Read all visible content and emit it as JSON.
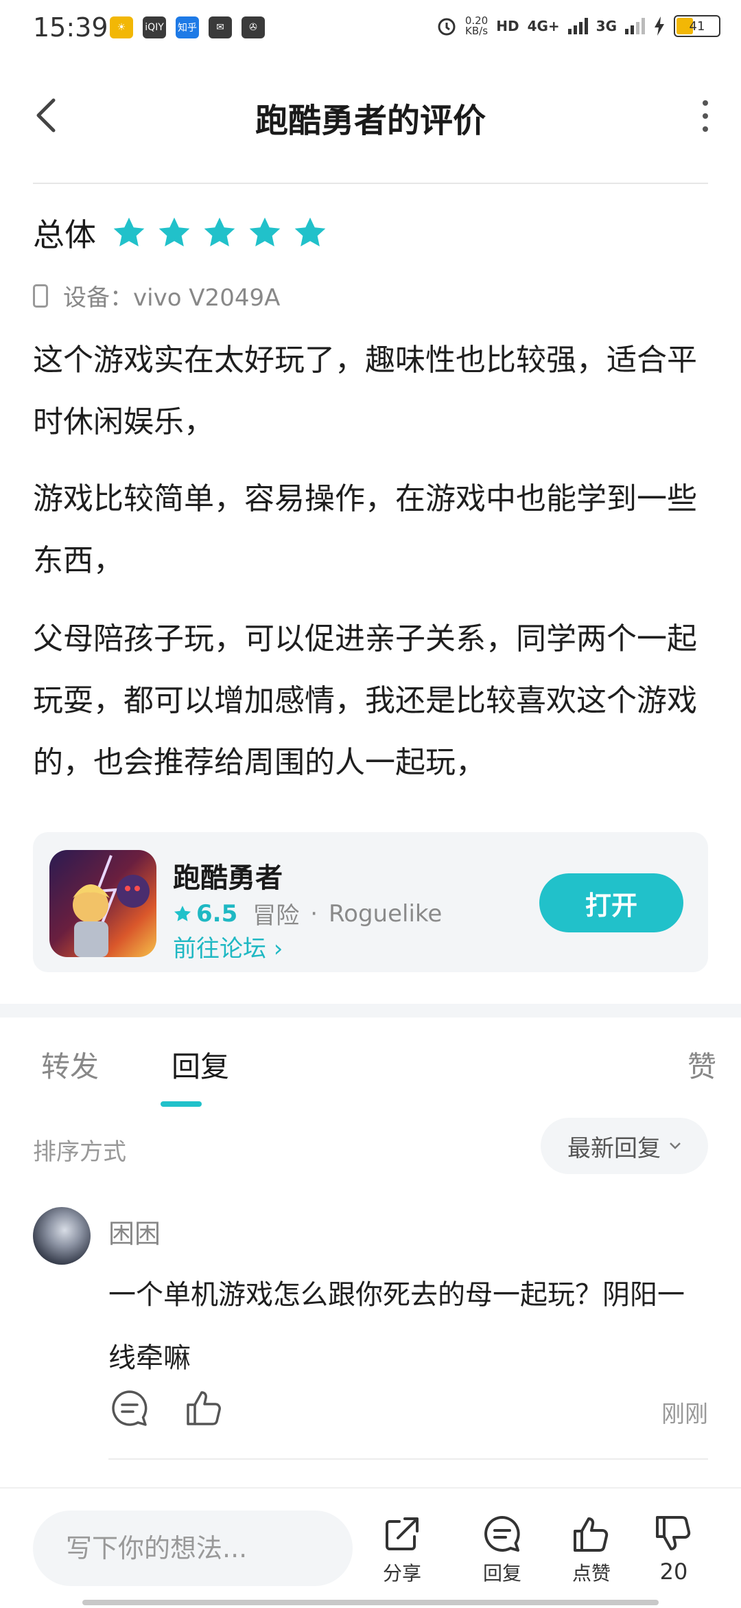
{
  "status_bar": {
    "time": "15:39",
    "net_speed": "0.20",
    "net_speed_unit": "KB/s",
    "hd": "HD",
    "net1": "4G+",
    "net2": "3G",
    "battery": "41",
    "app_icons": [
      "weather-icon",
      "iqiyi-icon",
      "zhihu-icon",
      "mail-icon",
      "vpn-icon"
    ],
    "zhihu_text": "知乎",
    "iqiyi_text": "iQIY"
  },
  "header": {
    "title": "跑酷勇者的评价"
  },
  "rating": {
    "label": "总体",
    "stars": 5,
    "star_color": "#21c1ca"
  },
  "device": {
    "label": "设备：vivo V2049A"
  },
  "review": {
    "paragraphs": [
      "这个游戏实在太好玩了，趣味性也比较强，适合平时休闲娱乐，",
      "游戏比较简单，容易操作，在游戏中也能学到一些东西，",
      "父母陪孩子玩，可以促进亲子关系，同学两个一起玩耍，都可以增加感情，我还是比较喜欢这个游戏的，也会推荐给周围的人一起玩，"
    ]
  },
  "game_card": {
    "name": "跑酷勇者",
    "score": "6.5",
    "genre": "冒险",
    "separator": "·",
    "tag": "Roguelike",
    "forum_link": "前往论坛 ›",
    "open_button": "打开",
    "accent_color": "#21c1ca"
  },
  "tabs": {
    "forward": "转发",
    "reply": "回复",
    "like": "赞",
    "active": "reply"
  },
  "sort": {
    "label": "排序方式",
    "selected": "最新回复"
  },
  "comments": [
    {
      "user": "困困",
      "text": "一个单机游戏怎么跟你死去的母一起玩？阴阳一线牵嘛",
      "time": "刚刚"
    }
  ],
  "bottom_bar": {
    "input_placeholder": "写下你的想法...",
    "share": "分享",
    "reply": "回复",
    "like": "点赞",
    "dislike_count": "20"
  }
}
